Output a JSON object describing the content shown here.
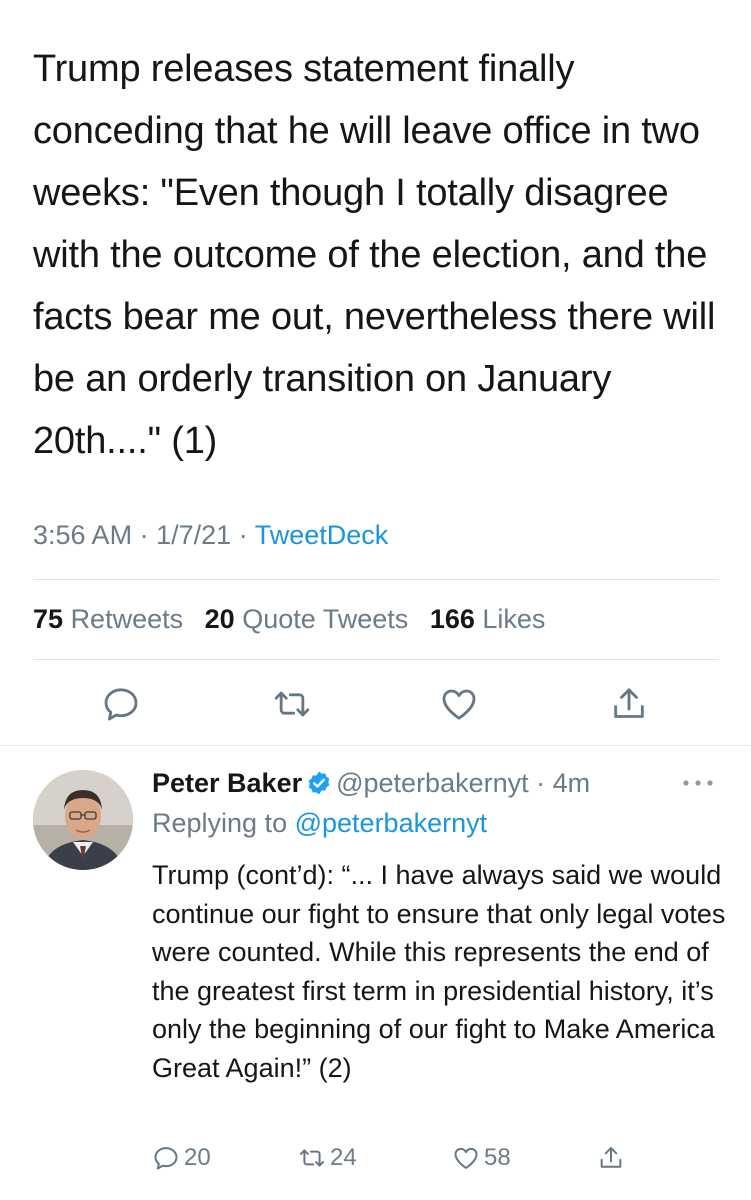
{
  "main_tweet": {
    "text": "Trump releases statement finally conceding that he will leave office in two weeks: \"Even though I totally disagree with the outcome of the election, and the facts bear me out, nevertheless there will be an orderly transition on January 20th....\" (1)",
    "time": "3:56 AM",
    "date": "1/7/21",
    "separator": "·",
    "source": "TweetDeck",
    "retweets_count": "75",
    "retweets_label": "Retweets",
    "quote_tweets_count": "20",
    "quote_tweets_label": "Quote Tweets",
    "likes_count": "166",
    "likes_label": "Likes",
    "actions": [
      "reply-icon",
      "retweet-icon",
      "like-icon",
      "share-icon"
    ]
  },
  "reply_tweet": {
    "display_name": "Peter Baker",
    "handle": "@peterbakernyt",
    "separator": "·",
    "time_ago": "4m",
    "replying_to_label": "Replying to",
    "replying_to_handle": "@peterbakernyt",
    "text": "Trump (cont’d): “... I have always said we would continue our fight to ensure that only legal votes were counted. While this represents the end of the greatest first term in presidential history, it’s only the beginning of our fight to Make America Great Again!” (2)",
    "reply_count": "20",
    "retweet_count": "24",
    "like_count": "58"
  },
  "colors": {
    "text": "#14171a",
    "secondary": "#6b7b8a",
    "link": "#1b95e0",
    "divider": "#dfe3e7",
    "icon": "#657786"
  }
}
